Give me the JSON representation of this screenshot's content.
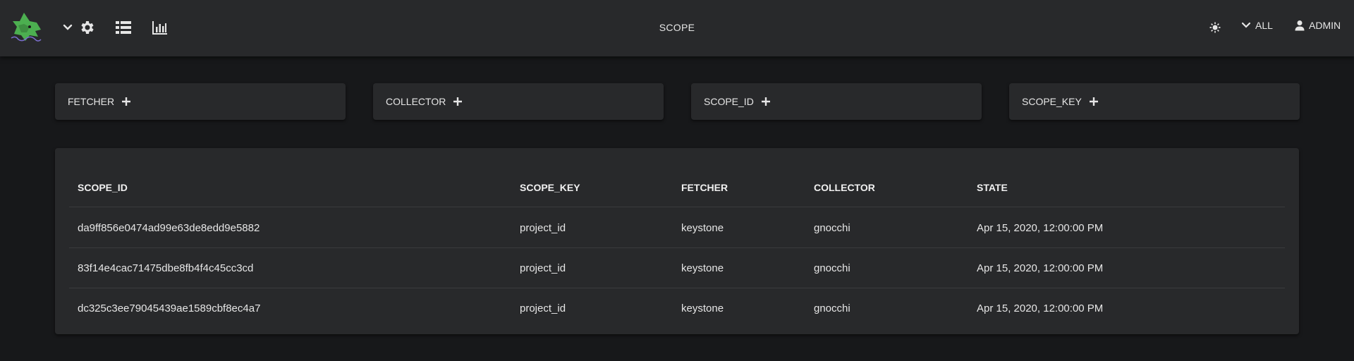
{
  "header": {
    "title": "SCOPE",
    "scope_filter_label": "ALL",
    "user_label": "ADMIN",
    "icons": [
      "logo",
      "chevron-down-icon",
      "gear-icon",
      "list-icon",
      "chart-icon",
      "theme-icon",
      "user-icon"
    ]
  },
  "filters": [
    {
      "label": "FETCHER"
    },
    {
      "label": "COLLECTOR"
    },
    {
      "label": "SCOPE_ID"
    },
    {
      "label": "SCOPE_KEY"
    }
  ],
  "table": {
    "columns": [
      "SCOPE_ID",
      "SCOPE_KEY",
      "FETCHER",
      "COLLECTOR",
      "STATE"
    ],
    "rows": [
      [
        "da9ff856e0474ad99e63de8edd9e5882",
        "project_id",
        "keystone",
        "gnocchi",
        "Apr 15, 2020, 12:00:00 PM"
      ],
      [
        "83f14e4cac71475dbe8fb4f4c45cc3cd",
        "project_id",
        "keystone",
        "gnocchi",
        "Apr 15, 2020, 12:00:00 PM"
      ],
      [
        "dc325c3ee79045439ae1589cbf8ec4a7",
        "project_id",
        "keystone",
        "gnocchi",
        "Apr 15, 2020, 12:00:00 PM"
      ]
    ]
  },
  "colors": {
    "background": "#17181a",
    "surface": "#28292b",
    "logo_green": "#4caf50"
  }
}
